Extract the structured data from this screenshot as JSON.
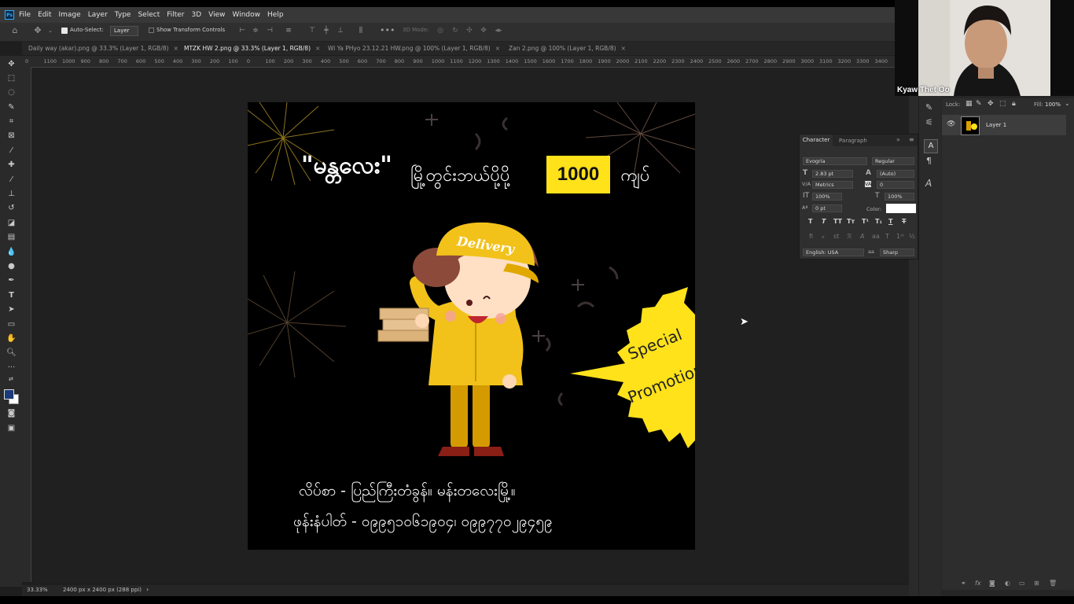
{
  "app": {
    "logo": "Ps",
    "menu": [
      "File",
      "Edit",
      "Image",
      "Layer",
      "Type",
      "Select",
      "Filter",
      "3D",
      "View",
      "Window",
      "Help"
    ]
  },
  "options": {
    "auto_select_label": "Auto-Select:",
    "auto_select_value": "Layer",
    "show_transform_label": "Show Transform Controls",
    "mode_3d_label": "3D Mode:"
  },
  "tabs": [
    {
      "label": "Daily way (akar).png @ 33.3% (Layer 1, RGB/8)",
      "active": false
    },
    {
      "label": "MTZK HW 2.png @ 33.3% (Layer 1, RGB/8)",
      "active": true
    },
    {
      "label": "Wi Ya PHyo 23.12.21 HW.png @ 100% (Layer 1, RGB/8)",
      "active": false
    },
    {
      "label": "Zan 2.png @ 100% (Layer 1, RGB/8)",
      "active": false
    }
  ],
  "ruler": {
    "h_ticks": [
      "0",
      "1100",
      "1000",
      "900",
      "800",
      "700",
      "600",
      "500",
      "400",
      "300",
      "200",
      "100",
      "0",
      "100",
      "200",
      "300",
      "400",
      "500",
      "600",
      "700",
      "800",
      "900",
      "1000",
      "1100",
      "1200",
      "1300",
      "1400",
      "1500",
      "1600",
      "1700",
      "1800",
      "1900",
      "2000",
      "2100",
      "2200",
      "2300",
      "2400",
      "2500",
      "2600",
      "2700",
      "2800",
      "2900",
      "3000",
      "3100",
      "3200",
      "3300",
      "3400"
    ]
  },
  "artwork": {
    "headline_quote": "\"မန္တလေး\"",
    "headline_text": "မြို့တွင်းဘယ်ပို့ပို့",
    "price": "1000",
    "currency": "ကျပ်",
    "cap_text": "Delivery",
    "badge_line1": "Special",
    "badge_line2": "Promotion",
    "address_line": "လိပ်စာ - ပြည်ကြီးတံခွန်။ မန်းတလေးမြို့။",
    "phone_line": "ဖုန်းနံပါတ် - ၀၉၉၅၁၀၆၁၉၀၄၊ ၀၉၉၇၇၀၂၉၄၅၉",
    "colors": {
      "yellow": "#ffe21a",
      "black": "#000000"
    }
  },
  "status": {
    "zoom": "33.33%",
    "doc_size": "2400 px x 2400 px (288 ppi)"
  },
  "character_panel": {
    "tab_character": "Character",
    "tab_paragraph": "Paragraph",
    "font_family": "Evogria",
    "font_style": "Regular",
    "font_size": "2.83 pt",
    "leading": "(Auto)",
    "kerning": "Metrics",
    "tracking": "0",
    "vertical_scale": "100%",
    "horizontal_scale": "100%",
    "baseline_shift": "0 pt",
    "color_label": "Color:",
    "language": "English: USA",
    "antialias_label": "aa",
    "antialias": "Sharp"
  },
  "layers": {
    "lock_label": "Lock:",
    "fill_label": "Fill:",
    "fill_value": "100%",
    "items": [
      {
        "name": "Layer 1"
      }
    ]
  },
  "webcam": {
    "participant_name": "Kyaw Thet Oo"
  }
}
